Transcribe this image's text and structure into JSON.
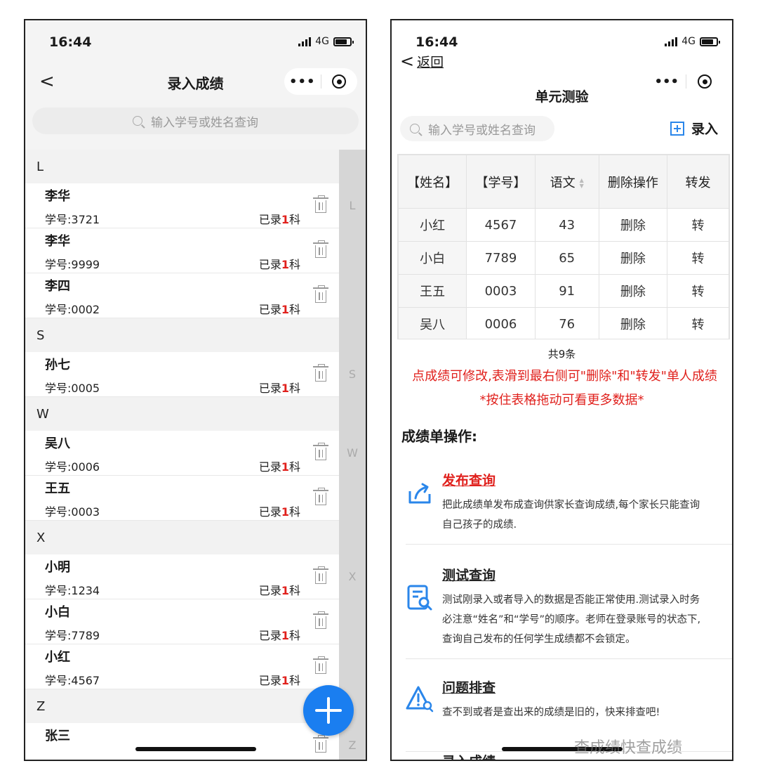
{
  "left": {
    "status": {
      "time": "16:44",
      "network": "4G"
    },
    "nav": {
      "back": "<",
      "title": "录入成绩",
      "menu": "•••"
    },
    "search": {
      "placeholder": "输入学号或姓名查询"
    },
    "groups": [
      {
        "letter": "L",
        "items": [
          {
            "name": "李华",
            "id": "学号:3721",
            "rec_pre": "已录",
            "rec_n": "1",
            "rec_post": "科"
          },
          {
            "name": "李华",
            "id": "学号:9999",
            "rec_pre": "已录",
            "rec_n": "1",
            "rec_post": "科"
          },
          {
            "name": "李四",
            "id": "学号:0002",
            "rec_pre": "已录",
            "rec_n": "1",
            "rec_post": "科"
          }
        ]
      },
      {
        "letter": "S",
        "items": [
          {
            "name": "孙七",
            "id": "学号:0005",
            "rec_pre": "已录",
            "rec_n": "1",
            "rec_post": "科"
          }
        ]
      },
      {
        "letter": "W",
        "items": [
          {
            "name": "吴八",
            "id": "学号:0006",
            "rec_pre": "已录",
            "rec_n": "1",
            "rec_post": "科"
          },
          {
            "name": "王五",
            "id": "学号:0003",
            "rec_pre": "已录",
            "rec_n": "1",
            "rec_post": "科"
          }
        ]
      },
      {
        "letter": "X",
        "items": [
          {
            "name": "小明",
            "id": "学号:1234",
            "rec_pre": "已录",
            "rec_n": "1",
            "rec_post": "科"
          },
          {
            "name": "小白",
            "id": "学号:7789",
            "rec_pre": "已录",
            "rec_n": "1",
            "rec_post": "科"
          },
          {
            "name": "小红",
            "id": "学号:4567",
            "rec_pre": "已录",
            "rec_n": "1",
            "rec_post": "科"
          }
        ]
      },
      {
        "letter": "Z",
        "items": [
          {
            "name": "张三",
            "id": "",
            "rec_pre": "",
            "rec_n": "",
            "rec_post": ""
          }
        ]
      }
    ],
    "index": [
      "L",
      "S",
      "W",
      "X",
      "Z"
    ]
  },
  "right": {
    "status": {
      "time": "16:44",
      "network": "4G"
    },
    "back_label": "返回",
    "menu": "•••",
    "title": "单元测验",
    "search": {
      "placeholder": "输入学号或姓名查询"
    },
    "add_label": "录入",
    "table": {
      "headers": [
        "【姓名】",
        "【学号】",
        "语文",
        "删除操作",
        "转发"
      ],
      "rows": [
        [
          "小红",
          "4567",
          "43",
          "删除",
          "转"
        ],
        [
          "小白",
          "7789",
          "65",
          "删除",
          "转"
        ],
        [
          "王五",
          "0003",
          "91",
          "删除",
          "转"
        ],
        [
          "吴八",
          "0006",
          "76",
          "删除",
          "转"
        ]
      ]
    },
    "total": "共9条",
    "note1": "点成绩可修改,表滑到最右侧可\"删除\"和\"转发\"单人成绩",
    "note2": "*按住表格拖动可看更多数据*",
    "ops_heading": "成绩单操作:",
    "ops": [
      {
        "title": "发布查询",
        "desc": "把此成绩单发布成查询供家长查询成绩,每个家长只能查询自己孩子的成绩."
      },
      {
        "title": "测试查询",
        "desc": "测试刚录入或者导入的数据是否能正常使用.测试录入时务必注意“姓名”和“学号”的顺序。老师在登录账号的状态下,查询自己发布的任何学生成绩都不会锁定。"
      },
      {
        "title": "问题排查",
        "desc": "查不到或者是查出来的成绩是旧的，快来排查吧!"
      },
      {
        "title": "录入成绩",
        "desc": ""
      }
    ],
    "accent": "#2a86ea",
    "alert_red": "#e0201c"
  },
  "watermark": "查成绩快查成绩"
}
